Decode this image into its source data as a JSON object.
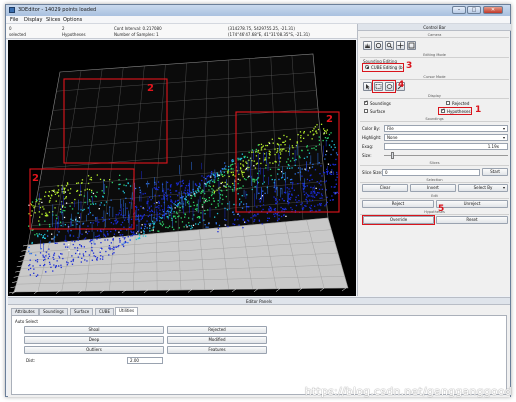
{
  "window": {
    "title": "3DEditor - 14029 points loaded",
    "controls": {
      "minimize": "–",
      "maximize": "□",
      "close": "✕"
    }
  },
  "menu": [
    "File",
    "Display",
    "Slices",
    "Options"
  ],
  "info": {
    "col1": [
      "0",
      "selected"
    ],
    "col2": [
      "2",
      "Hypotheses"
    ],
    "col3": [
      "Cont Interval: 0.217080",
      "Number of Samples: 1"
    ],
    "col4": [
      "(314278.75, 5429755.25, -21.31)",
      "(174°46'47.68\"E, 41°31'08.35\"S, -21.31)"
    ]
  },
  "viewport_labels": [
    "2",
    "2",
    "2"
  ],
  "control_bar": {
    "title": "Control Bar",
    "camera_label": "Camera",
    "editing_mode_label": "Editing Mode",
    "sounding_editing": "Sounding Editing",
    "cube_editing": "CUBE Editing (b)",
    "cursor_mode_label": "Cursor Mode",
    "display_label": "Display",
    "soundings": "Soundings",
    "rejected": "Rejected",
    "surface": "Surface",
    "hypotheses": "Hypotheses",
    "soundings_sub": "Soundings",
    "color_by_label": "Color By:",
    "color_by_value": "File",
    "highlight_label": "Highlight:",
    "highlight_value": "None",
    "exag_label": "Exag:",
    "exag_value": "1.19x",
    "size_label": "Size:",
    "slices_label": "Slices",
    "slice_size_label": "Slice Size:",
    "slice_size_value": "0",
    "start": "Start",
    "selection_label": "Selection",
    "clear": "Clear",
    "invert": "Invert",
    "select_by": "Select By",
    "edit_label": "Edit",
    "reject": "Reject",
    "unreject": "Unreject",
    "hypotheses_label": "Hypotheses",
    "override": "Override",
    "reset": "Reset",
    "markers": [
      "1",
      "3",
      "4",
      "5"
    ]
  },
  "editor": {
    "title": "Editor Panels",
    "tabs": [
      "Attributes",
      "Soundings",
      "Surface",
      "CUBE",
      "Utilities"
    ],
    "active_tab": "Utilities",
    "auto_select": "Auto Select",
    "buttons_left": [
      "Shoal",
      "Deep",
      "Outliers"
    ],
    "buttons_right": [
      "Rejected",
      "Modified",
      "Features"
    ],
    "distance_label": "Dist:",
    "distance_value": "2.00"
  },
  "watermark": "https://blog.csdn.net/gangganggood",
  "colors": {
    "marker_red": "#d9141c",
    "points_palette": [
      "#1a2bd6",
      "#2f73e6",
      "#22c3d6",
      "#2fd36a",
      "#b6ef2c",
      "#ffffff"
    ]
  }
}
